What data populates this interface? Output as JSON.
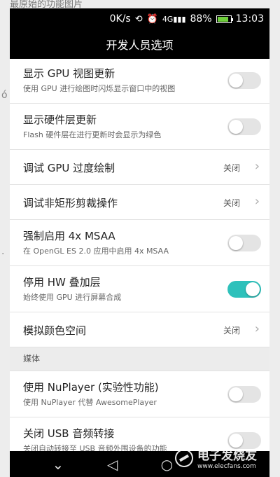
{
  "background": {
    "top_text": "最原始的功能图片"
  },
  "statusbar": {
    "network_speed": "0K/s",
    "signal_label": "4G",
    "battery_percent": "88%",
    "time": "13:03",
    "battery_color": "#6fcf3c"
  },
  "appbar": {
    "title": "开发人员选项"
  },
  "items": [
    {
      "title": "显示 GPU 视图更新",
      "subtitle": "使用 GPU 进行绘图时闪烁显示窗口中的视图",
      "toggle": false
    },
    {
      "title": "显示硬件层更新",
      "subtitle": "Flash 硬件层在进行更新时会显示为绿色",
      "toggle": false
    },
    {
      "title": "调试 GPU 过度绘制",
      "value": "关闭"
    },
    {
      "title": "调试非矩形剪裁操作",
      "value": "关闭"
    },
    {
      "title": "强制启用 4x MSAA",
      "subtitle": "在 OpenGL ES 2.0 应用中启用 4x MSAA",
      "toggle": false
    },
    {
      "title": "停用 HW 叠加层",
      "subtitle": "始终使用 GPU 进行屏幕合成",
      "toggle": true
    },
    {
      "title": "模拟颜色空间",
      "value": "关闭"
    }
  ],
  "section_media": {
    "label": "媒体"
  },
  "media_items": [
    {
      "title": "使用 NuPlayer (实验性功能)",
      "subtitle": "使用 NuPlayer 代替 AwesomePlayer",
      "toggle": false
    },
    {
      "title": "关闭 USB 音频转接",
      "subtitle": "关闭自动转接至 USB 音频外围设备的功能",
      "toggle": false
    }
  ],
  "watermark": {
    "brand": "电子发烧友",
    "url": "www.elecfans.com"
  },
  "colors": {
    "toggle_on": "#2ec1bb",
    "toggle_off": "#e4e4e4"
  },
  "icons": [
    "back-icon",
    "home-icon",
    "chevron-down-icon",
    "chevron-right-icon",
    "alarm-icon",
    "signal-icon",
    "battery-icon"
  ]
}
